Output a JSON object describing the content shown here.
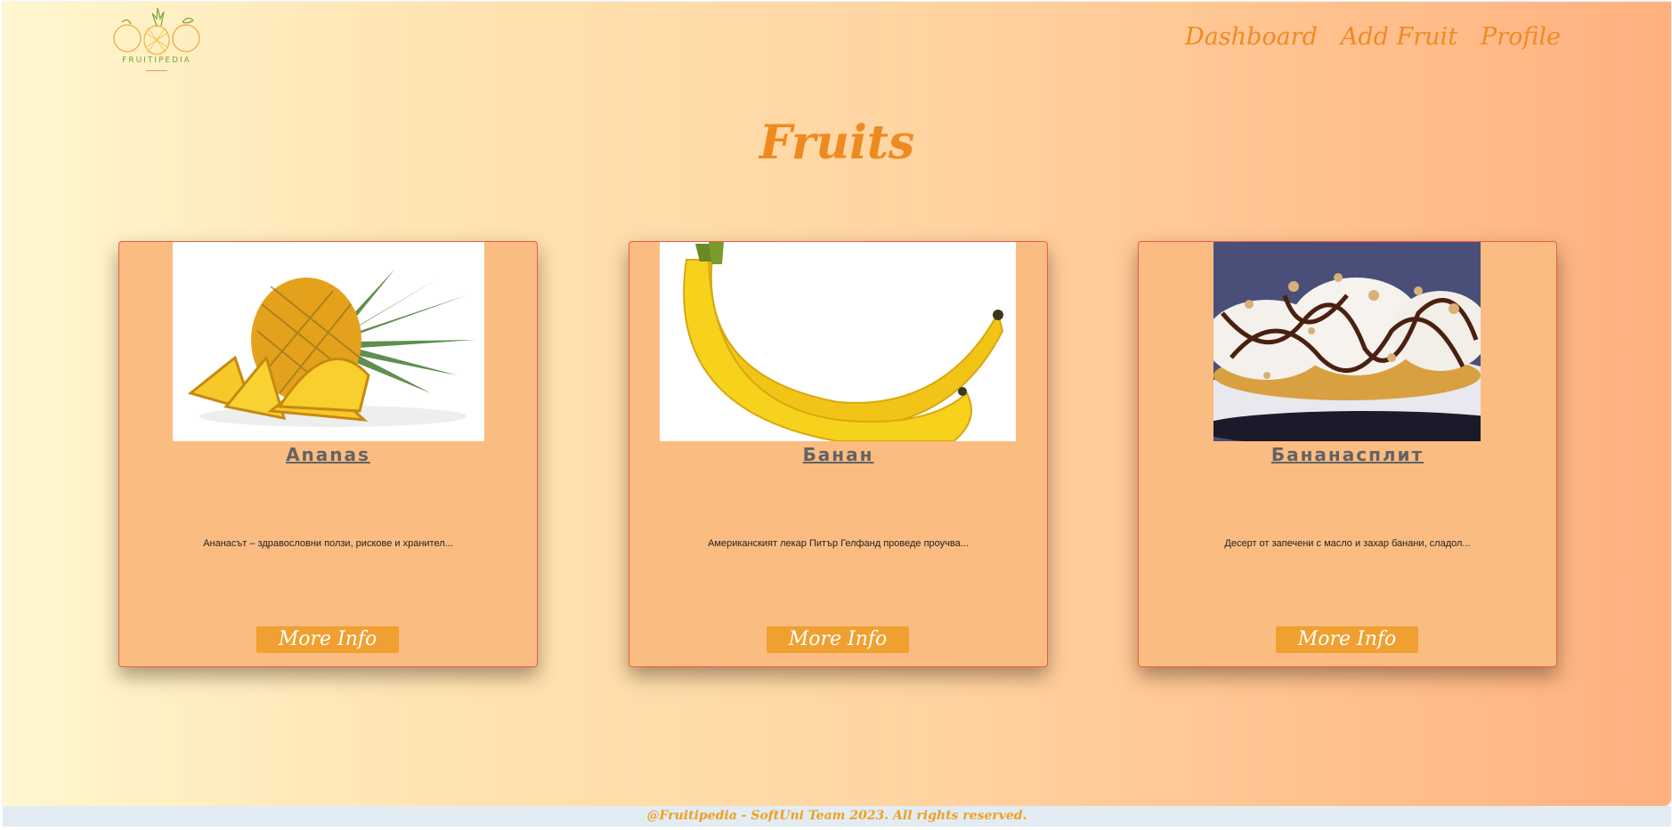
{
  "brand": {
    "logo_text": "FRUITIPEDIA",
    "logo_icon": "fruit-trio-logo"
  },
  "nav": {
    "items": [
      "Dashboard",
      "Add Fruit",
      "Profile"
    ]
  },
  "page_title": "Fruits",
  "cards": [
    {
      "name": "Ananas",
      "description": "Ананасът – здравословни ползи, рискове и хранител...",
      "button": "More Info",
      "image": "pineapple"
    },
    {
      "name": "Банан",
      "description": "Американският лекар Питър Гелфанд проведе проучва...",
      "button": "More Info",
      "image": "bananas"
    },
    {
      "name": "Бананасплит",
      "description": "Десерт от запечени с масло и захар банани, сладол...",
      "button": "More Info",
      "image": "banana-split"
    }
  ],
  "footer": {
    "text": "@Fruitipedia - SoftUni Team 2023. All rights reserved."
  },
  "colors": {
    "accent": "#f08a23",
    "card_bg": "#fbbc82",
    "button_bg": "#f0a030",
    "card_border": "#ef5a4a"
  }
}
